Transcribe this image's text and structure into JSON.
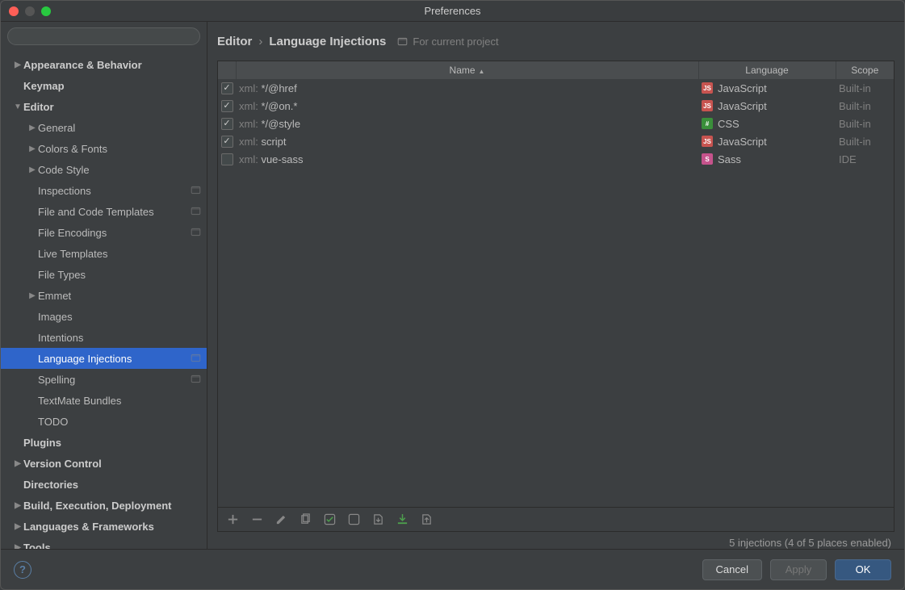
{
  "window": {
    "title": "Preferences"
  },
  "search": {
    "placeholder": ""
  },
  "sidebar": {
    "items": [
      {
        "label": "Appearance & Behavior",
        "depth": 1,
        "bold": true,
        "arrow": "▶"
      },
      {
        "label": "Keymap",
        "depth": 1,
        "bold": true
      },
      {
        "label": "Editor",
        "depth": 1,
        "bold": true,
        "arrow": "▼"
      },
      {
        "label": "General",
        "depth": 2,
        "arrow": "▶"
      },
      {
        "label": "Colors & Fonts",
        "depth": 2,
        "arrow": "▶"
      },
      {
        "label": "Code Style",
        "depth": 2,
        "arrow": "▶"
      },
      {
        "label": "Inspections",
        "depth": 2,
        "proj": true
      },
      {
        "label": "File and Code Templates",
        "depth": 2,
        "proj": true
      },
      {
        "label": "File Encodings",
        "depth": 2,
        "proj": true
      },
      {
        "label": "Live Templates",
        "depth": 2
      },
      {
        "label": "File Types",
        "depth": 2
      },
      {
        "label": "Emmet",
        "depth": 2,
        "arrow": "▶"
      },
      {
        "label": "Images",
        "depth": 2
      },
      {
        "label": "Intentions",
        "depth": 2
      },
      {
        "label": "Language Injections",
        "depth": 2,
        "proj": true,
        "selected": true
      },
      {
        "label": "Spelling",
        "depth": 2,
        "proj": true
      },
      {
        "label": "TextMate Bundles",
        "depth": 2
      },
      {
        "label": "TODO",
        "depth": 2
      },
      {
        "label": "Plugins",
        "depth": 1,
        "bold": true
      },
      {
        "label": "Version Control",
        "depth": 1,
        "bold": true,
        "arrow": "▶"
      },
      {
        "label": "Directories",
        "depth": 1,
        "bold": true
      },
      {
        "label": "Build, Execution, Deployment",
        "depth": 1,
        "bold": true,
        "arrow": "▶"
      },
      {
        "label": "Languages & Frameworks",
        "depth": 1,
        "bold": true,
        "arrow": "▶"
      },
      {
        "label": "Tools",
        "depth": 1,
        "bold": true,
        "arrow": "▶"
      }
    ]
  },
  "breadcrumb": {
    "a": "Editor",
    "b": "Language Injections",
    "for_project": "For current project"
  },
  "table": {
    "headers": {
      "name": "Name",
      "language": "Language",
      "scope": "Scope"
    },
    "rows": [
      {
        "checked": true,
        "prefix": "xml:",
        "name": "*/@href",
        "lang": "JavaScript",
        "langIcon": "js",
        "scope": "Built-in"
      },
      {
        "checked": true,
        "prefix": "xml:",
        "name": "*/@on.*",
        "lang": "JavaScript",
        "langIcon": "js",
        "scope": "Built-in"
      },
      {
        "checked": true,
        "prefix": "xml:",
        "name": "*/@style",
        "lang": "CSS",
        "langIcon": "css",
        "scope": "Built-in"
      },
      {
        "checked": true,
        "prefix": "xml:",
        "name": "script",
        "lang": "JavaScript",
        "langIcon": "js",
        "scope": "Built-in"
      },
      {
        "checked": false,
        "prefix": "xml:",
        "name": "vue-sass",
        "lang": "Sass",
        "langIcon": "sass",
        "scope": "IDE"
      }
    ]
  },
  "status": "5 injections (4 of 5 places enabled)",
  "buttons": {
    "cancel": "Cancel",
    "apply": "Apply",
    "ok": "OK",
    "help": "?"
  }
}
